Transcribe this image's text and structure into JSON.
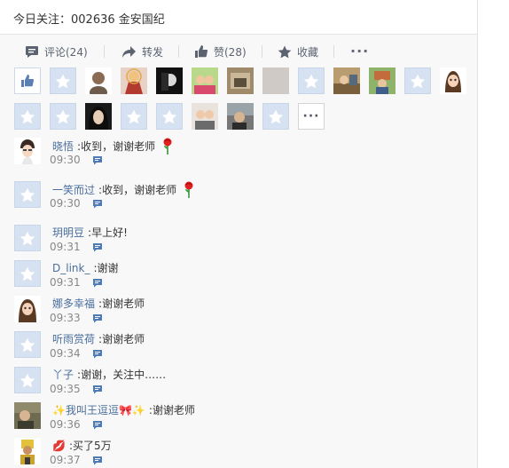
{
  "post": {
    "text": "今日关注：002636 金安国纪"
  },
  "actions": {
    "comment_label": "评论(24)",
    "repost_label": "转发",
    "like_label": "赞(28)",
    "favorite_label": "收藏",
    "more_label": "···"
  },
  "likers": {
    "more_label": "···"
  },
  "comments": [
    {
      "name": "晓悟",
      "text": "收到，谢谢老师",
      "time": "09:30"
    },
    {
      "name": "一笑而过",
      "text": "收到，谢谢老师",
      "time": "09:30"
    },
    {
      "name": "玥明豆",
      "text": "早上好!",
      "time": "09:31"
    },
    {
      "name": "D_link_",
      "text": "谢谢",
      "time": "09:31"
    },
    {
      "name": "娜多幸福",
      "text": "谢谢老师",
      "time": "09:33"
    },
    {
      "name": "听雨赏荷",
      "text": "谢谢老师",
      "time": "09:34"
    },
    {
      "name": "丫子",
      "text": "谢谢，关注中……",
      "time": "09:35"
    },
    {
      "name": "✨我叫王逗逗🎀✨",
      "text": "谢谢老师",
      "time": "09:36"
    },
    {
      "name": "💋",
      "text": "买了5万",
      "time": "09:37"
    }
  ],
  "colors": {
    "link": "#4a6e9c",
    "icon": "#5b6370",
    "default_avatar": "#d6e2f1"
  }
}
